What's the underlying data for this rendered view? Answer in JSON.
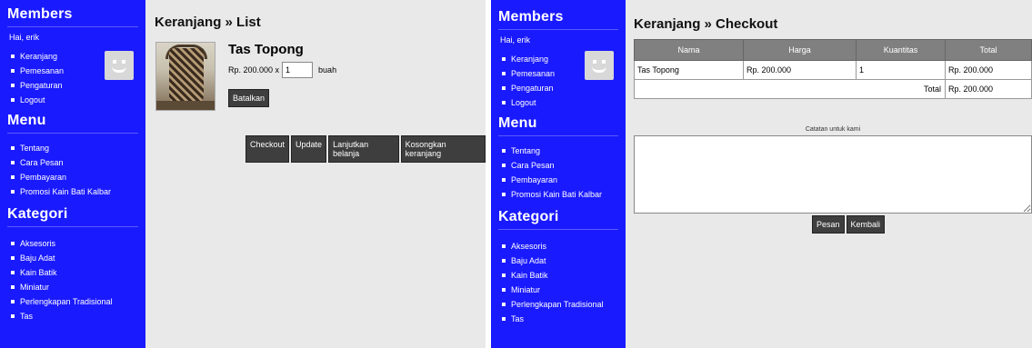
{
  "sidebar": {
    "members_heading": "Members",
    "greeting": "Hai, erik",
    "member_links": [
      "Keranjang",
      "Pemesanan",
      "Pengaturan",
      "Logout"
    ],
    "menu_heading": "Menu",
    "menu_links": [
      "Tentang",
      "Cara Pesan",
      "Pembayaran",
      "Promosi Kain Bati Kalbar"
    ],
    "category_heading": "Kategori",
    "category_links": [
      "Aksesoris",
      "Baju Adat",
      "Kain Batik",
      "Miniatur",
      "Perlengkapan Tradisional",
      "Tas"
    ]
  },
  "cart": {
    "title": "Keranjang » List",
    "product_name": "Tas Topong",
    "price_text": "Rp. 200.000 x",
    "quantity": "1",
    "unit": "buah",
    "cancel_label": "Batalkan",
    "actions": [
      "Checkout",
      "Update",
      "Lanjutkan belanja",
      "Kosongkan keranjang"
    ]
  },
  "checkout": {
    "title": "Keranjang » Checkout",
    "headers": [
      "Nama",
      "Harga",
      "Kuantitas",
      "Total"
    ],
    "rows": [
      {
        "nama": "Tas Topong",
        "harga": "Rp. 200.000",
        "kuantitas": "1",
        "total": "Rp. 200.000"
      }
    ],
    "total_label": "Total",
    "total_value": "Rp. 200.000",
    "notes_label": "Catatan untuk kami",
    "order_label": "Pesan",
    "back_label": "Kembali"
  },
  "colors": {
    "sidebar_bg": "#1a1aff",
    "content_bg": "#e9e9e9",
    "button_bg": "#3e3e3e",
    "table_header_bg": "#808080"
  },
  "icons": {
    "avatar": "smiley-avatar-icon",
    "list_bullet": "square-bullet-icon"
  }
}
